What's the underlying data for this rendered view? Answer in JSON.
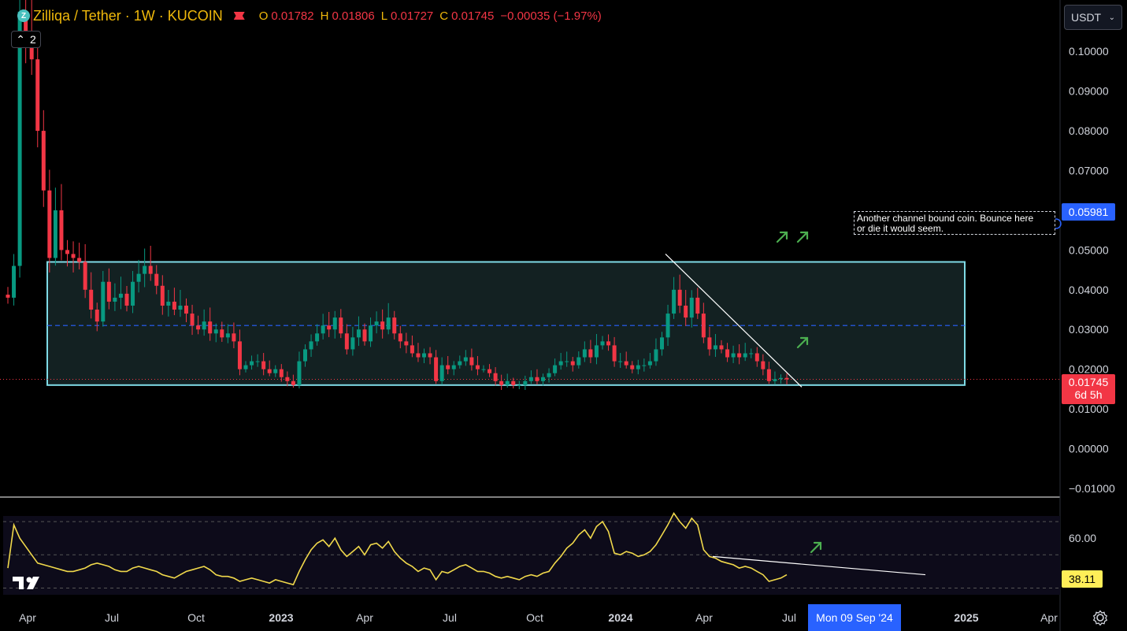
{
  "legend": {
    "symbol": "Zilliqa / Tether · 1W · KUCOIN",
    "ohlc": [
      {
        "k": "O",
        "v": "0.01782"
      },
      {
        "k": "H",
        "v": "0.01806"
      },
      {
        "k": "L",
        "v": "0.01727"
      },
      {
        "k": "C",
        "v": "0.01745"
      }
    ],
    "change": "−0.00035 (−1.97%)"
  },
  "collapse": {
    "count": "2"
  },
  "currency": {
    "label": "USDT"
  },
  "note": {
    "line1": "Another channel bound coin. Bounce here",
    "line2": "or die it would seem."
  },
  "tags": {
    "alert_price": "0.05981",
    "last_price": "0.01745",
    "countdown": "6d 5h",
    "rsi_value": "38.11"
  },
  "crosshair_date": "Mon 09 Sep '24",
  "icons": {
    "coin": "zilliqa-coin-icon",
    "flag": "flag-icon",
    "chevron": "chevron-down-icon",
    "settings": "gear-icon",
    "logo": "tradingview-logo-icon",
    "arrows": "arrow-up-right-icon"
  },
  "colors": {
    "up": "#089981",
    "down": "#f23645",
    "channel": "#7fdbe6",
    "rsi": "#f0d84b",
    "accent": "#2962ff"
  },
  "chart_data": [
    {
      "type": "candlestick",
      "title": "Zilliqa / Tether · 1W · KUCOIN",
      "y_ticks": [
        0.1,
        0.09,
        0.08,
        0.07,
        0.06,
        0.05,
        0.04,
        0.03,
        0.02,
        0.01,
        0.0,
        -0.01
      ],
      "y_tick_labels": [
        "0.10000",
        "0.09000",
        "0.08000",
        "0.07000",
        "",
        "0.05000",
        "0.04000",
        "0.03000",
        "0.02000",
        "0.01000",
        "0.00000",
        "−0.01000"
      ],
      "ylim": [
        -0.011,
        0.105
      ],
      "x_ticks": [
        "Apr",
        "Jul",
        "Oct",
        "2023",
        "Apr",
        "Jul",
        "Oct",
        "2024",
        "Apr",
        "Jul",
        "2025",
        "Apr"
      ],
      "channel": {
        "top": 0.047,
        "mid": 0.031,
        "bottom": 0.016
      },
      "trendline": {
        "from": [
          0.049
        ],
        "to": [
          0.0155
        ]
      },
      "last_price": 0.01745,
      "closes": [
        0.038,
        0.046,
        0.11,
        0.105,
        0.098,
        0.08,
        0.065,
        0.048,
        0.06,
        0.05,
        0.049,
        0.048,
        0.047,
        0.04,
        0.035,
        0.032,
        0.042,
        0.037,
        0.038,
        0.039,
        0.036,
        0.042,
        0.044,
        0.046,
        0.044,
        0.041,
        0.036,
        0.037,
        0.035,
        0.036,
        0.034,
        0.031,
        0.03,
        0.032,
        0.029,
        0.03,
        0.028,
        0.029,
        0.027,
        0.02,
        0.021,
        0.022,
        0.022,
        0.02,
        0.019,
        0.02,
        0.018,
        0.017,
        0.016,
        0.022,
        0.025,
        0.027,
        0.029,
        0.031,
        0.03,
        0.033,
        0.029,
        0.025,
        0.028,
        0.03,
        0.027,
        0.031,
        0.032,
        0.03,
        0.033,
        0.029,
        0.027,
        0.026,
        0.024,
        0.023,
        0.024,
        0.023,
        0.017,
        0.021,
        0.02,
        0.021,
        0.022,
        0.023,
        0.021,
        0.02,
        0.02,
        0.019,
        0.017,
        0.016,
        0.017,
        0.016,
        0.016,
        0.017,
        0.018,
        0.017,
        0.018,
        0.019,
        0.021,
        0.022,
        0.022,
        0.021,
        0.023,
        0.025,
        0.023,
        0.026,
        0.027,
        0.026,
        0.022,
        0.022,
        0.021,
        0.02,
        0.021,
        0.021,
        0.022,
        0.025,
        0.028,
        0.034,
        0.04,
        0.036,
        0.033,
        0.038,
        0.034,
        0.028,
        0.025,
        0.026,
        0.025,
        0.023,
        0.024,
        0.023,
        0.024,
        0.024,
        0.022,
        0.02,
        0.017,
        0.0175,
        0.0178,
        0.01745
      ]
    },
    {
      "type": "line",
      "series": [
        {
          "name": "RSI",
          "values": [
            42,
            68,
            60,
            55,
            50,
            45,
            44,
            43,
            42,
            41,
            40,
            40,
            41,
            42,
            44,
            45,
            44,
            43,
            41,
            40,
            40,
            42,
            43,
            42,
            41,
            40,
            38,
            37,
            36,
            38,
            40,
            41,
            42,
            43,
            41,
            38,
            37,
            37,
            36,
            34,
            35,
            36,
            35,
            34,
            33,
            35,
            34,
            33,
            32,
            40,
            47,
            53,
            57,
            59,
            55,
            60,
            53,
            49,
            52,
            55,
            50,
            56,
            57,
            54,
            58,
            52,
            48,
            45,
            43,
            40,
            42,
            41,
            35,
            40,
            39,
            41,
            43,
            44,
            42,
            40,
            40,
            39,
            37,
            36,
            37,
            36,
            35,
            37,
            38,
            37,
            39,
            40,
            45,
            49,
            54,
            57,
            62,
            65,
            60,
            67,
            70,
            64,
            51,
            50,
            52,
            51,
            49,
            50,
            52,
            56,
            62,
            68,
            75,
            70,
            66,
            72,
            68,
            53,
            49,
            48,
            46,
            45,
            44,
            42,
            43,
            42,
            40,
            38,
            34,
            35,
            36,
            38
          ]
        }
      ],
      "ylim": [
        25,
        80
      ],
      "y_tick_labels": [
        "60.00"
      ],
      "guides": [
        70,
        50,
        30
      ],
      "trendline": {
        "from": 49,
        "to": 38
      }
    }
  ]
}
